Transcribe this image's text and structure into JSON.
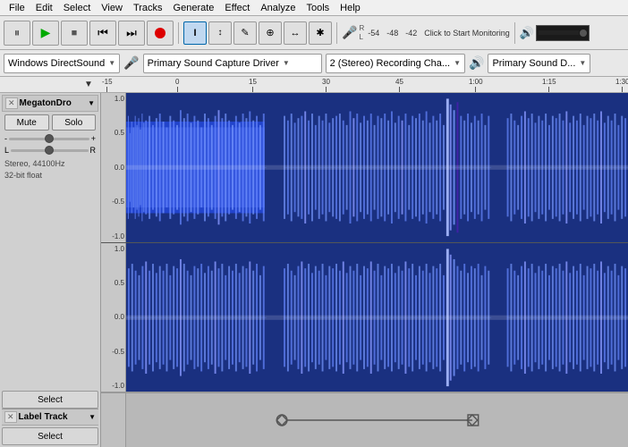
{
  "menubar": {
    "items": [
      "File",
      "Edit",
      "Select",
      "View",
      "Tracks",
      "Generate",
      "Effect",
      "Analyze",
      "Tools",
      "Help"
    ]
  },
  "toolbar1": {
    "buttons": [
      {
        "id": "pause",
        "icon": "⏸",
        "label": "Pause"
      },
      {
        "id": "play",
        "icon": "▶",
        "label": "Play"
      },
      {
        "id": "stop",
        "icon": "■",
        "label": "Stop"
      },
      {
        "id": "skip-back",
        "icon": "⏮",
        "label": "Skip to Start"
      },
      {
        "id": "skip-fwd",
        "icon": "⏭",
        "label": "Skip to End"
      },
      {
        "id": "record",
        "icon": "●",
        "label": "Record"
      }
    ],
    "tools": [
      {
        "id": "select-tool",
        "icon": "I",
        "label": "Selection Tool"
      },
      {
        "id": "envelope-tool",
        "icon": "↕",
        "label": "Envelope Tool"
      },
      {
        "id": "draw-tool",
        "icon": "✎",
        "label": "Draw Tool"
      },
      {
        "id": "zoom-tool",
        "icon": "🔍",
        "label": "Zoom Tool"
      },
      {
        "id": "timeshift-tool",
        "icon": "↔",
        "label": "Time Shift Tool"
      },
      {
        "id": "multi-tool",
        "icon": "✱",
        "label": "Multi Tool"
      }
    ],
    "vu": {
      "record_label": "R",
      "play_label": "L",
      "levels": [
        "-54",
        "-48",
        "-42"
      ],
      "click_to_monitor": "Click to Start Monitoring",
      "volume_icon": "🔊"
    }
  },
  "toolbar2": {
    "audio_host": "Windows DirectSound",
    "input_device": "Primary Sound Capture Driver",
    "channels": "2 (Stereo) Recording Cha...",
    "output_device": "Primary Sound D..."
  },
  "ruler": {
    "arrow": "▼",
    "marks": [
      {
        "pos": 0,
        "label": "-15"
      },
      {
        "pos": 82,
        "label": "0"
      },
      {
        "pos": 164,
        "label": "15"
      },
      {
        "pos": 246,
        "label": "30"
      },
      {
        "pos": 328,
        "label": "45"
      },
      {
        "pos": 410,
        "label": "1:00"
      },
      {
        "pos": 492,
        "label": "1:15"
      },
      {
        "pos": 574,
        "label": "1:30"
      }
    ]
  },
  "tracks": [
    {
      "id": "main-track",
      "name": "MegatonDro",
      "mute_label": "Mute",
      "solo_label": "Solo",
      "volume_minus": "-",
      "volume_plus": "+",
      "pan_left": "L",
      "pan_right": "R",
      "info": "Stereo, 44100Hz\n32-bit float",
      "select_label": "Select",
      "scale": [
        "1.0",
        "0.5",
        "0.0",
        "-0.5",
        "-1.0",
        "1.0",
        "0.5",
        "0.0",
        "-0.5",
        "-1.0"
      ]
    }
  ],
  "label_track": {
    "name": "Label Track",
    "select_label": "Select"
  }
}
